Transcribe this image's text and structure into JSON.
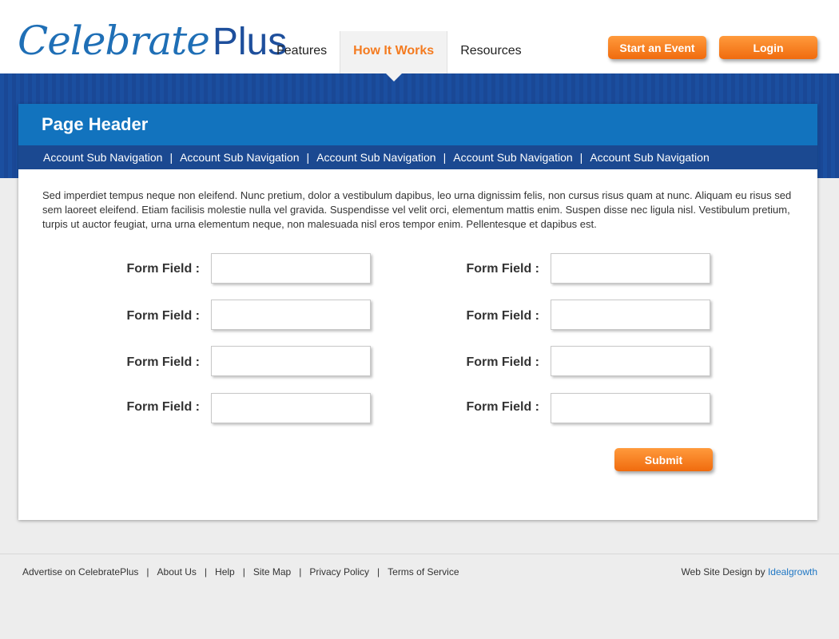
{
  "logo": {
    "script": "Celebrate",
    "plus": "Plus"
  },
  "nav": [
    {
      "label": "Features"
    },
    {
      "label": "How It Works",
      "active": true
    },
    {
      "label": "Resources"
    }
  ],
  "header_buttons": {
    "start_event": "Start an Event",
    "login": "Login"
  },
  "page": {
    "title": "Page Header",
    "subnav": [
      "Account Sub Navigation",
      "Account Sub Navigation",
      "Account Sub Navigation",
      "Account Sub Navigation",
      "Account Sub Navigation"
    ],
    "subnav_separator": "|",
    "intro": "Sed imperdiet tempus neque non eleifend. Nunc pretium, dolor a vestibulum dapibus, leo urna dignissim felis, non cursus risus quam at nunc. Aliquam eu risus sed sem laoreet eleifend. Etiam facilisis molestie nulla vel gravida. Suspendisse vel velit orci, elementum mattis enim. Suspen disse nec ligula nisl. Vestibulum pretium, turpis ut auctor feugiat, urna urna elementum neque, non malesuada nisl eros tempor enim. Pellentesque et dapibus est."
  },
  "form": {
    "field_label": "Form Field :",
    "field_value": "",
    "submit": "Submit"
  },
  "footer": {
    "links": [
      "Advertise on CelebratePlus",
      "About Us",
      "Help",
      "Site Map",
      "Privacy Policy",
      "Terms of Service"
    ],
    "separator": "|",
    "credit_prefix": "Web Site Design by",
    "credit_brand": "Idealgrowth"
  },
  "colors": {
    "brand_blue": "#1273be",
    "subnav_blue": "#1b4991",
    "accent_orange": "#f47b20",
    "link_blue": "#1f77c4"
  }
}
